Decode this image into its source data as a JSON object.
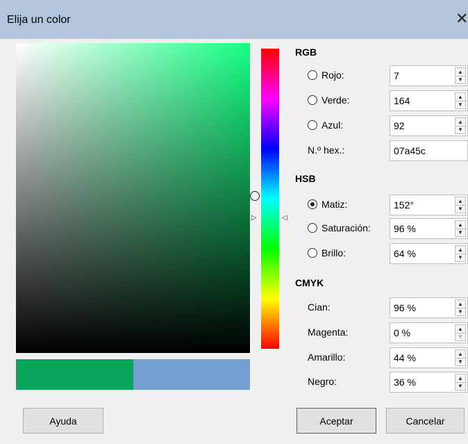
{
  "window": {
    "title": "Elija un color",
    "close_glyph": "✕"
  },
  "picker": {
    "hue_marker_left": "▷",
    "hue_marker_right": "◁"
  },
  "rgb": {
    "title": "RGB",
    "red_label": "Rojo:",
    "red_value": "7",
    "green_label": "Verde:",
    "green_value": "164",
    "blue_label": "Azul:",
    "blue_value": "92",
    "hex_label": "N.º hex.:",
    "hex_value": "07a45c"
  },
  "hsb": {
    "title": "HSB",
    "hue_label": "Matiz:",
    "hue_value": "152°",
    "saturation_label": "Saturación:",
    "saturation_value": "96 %",
    "brightness_label": "Brillo:",
    "brightness_value": "64 %",
    "selected": "hue"
  },
  "cmyk": {
    "title": "CMYK",
    "cyan_label": "Cian:",
    "cyan_value": "96 %",
    "magenta_label": "Magenta:",
    "magenta_value": "0 %",
    "yellow_label": "Amarillo:",
    "yellow_value": "44 %",
    "black_label": "Negro:",
    "black_value": "36 %"
  },
  "swatches": {
    "new_color": "#07a45c",
    "old_color": "#729fcf"
  },
  "spin": {
    "up": "▲",
    "down": "▼"
  },
  "buttons": {
    "help": "Ayuda",
    "ok": "Aceptar",
    "cancel": "Cancelar"
  }
}
